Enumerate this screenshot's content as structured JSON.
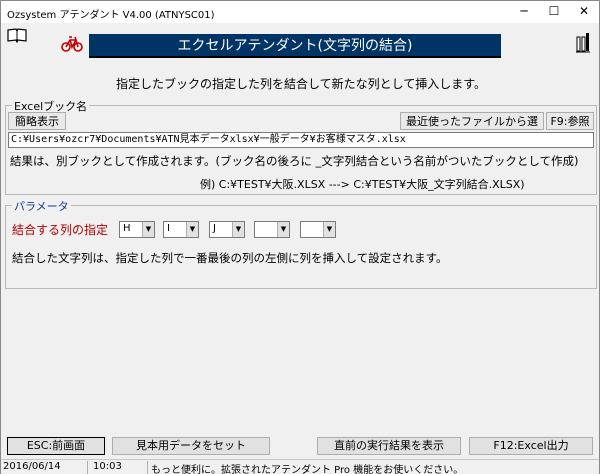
{
  "window": {
    "title": "Ozsystem アテンダント V4.00 (ATNYSC01)",
    "min_label": "─",
    "max_label": "☐",
    "close_label": "✕"
  },
  "header": {
    "banner": "エクセルアテンダント(文字列の結合)",
    "banner_color": "#003366"
  },
  "intro": "指定したブックの指定した列を結合して新たな列として挿入します。",
  "excel_group": {
    "label": "Excelブック名",
    "brief_button": "簡略表示",
    "recent_button": "最近使ったファイルから選択",
    "ref_button": "F9:参照",
    "file_path": "C:¥Users¥ozcr7¥Documents¥ATN見本データxlsx¥一般データ¥お客様マスタ.xlsx",
    "note": "結果は、別ブックとして作成されます。(ブック名の後ろに _文字列結合という名前がついたブックとして作成)",
    "example": "例) C:¥TEST¥大阪.XLSX ---> C:¥TEST¥大阪_文字列結合.XLSX)"
  },
  "param_group": {
    "label": "パラメータ",
    "columns_label": "結合する列の指定",
    "columns": [
      "H",
      "I",
      "J",
      "",
      ""
    ],
    "note": "結合した文字列は、指定した列で一番最後の列の左側に列を挿入して設定されます。"
  },
  "footer": {
    "esc_button": "ESC:前画面",
    "sample_button": "見本用データをセット",
    "prev_result_button": "直前の実行結果を表示",
    "f12_button": "F12:Excel出力"
  },
  "status": {
    "date": "2016/06/14",
    "time": "10:03",
    "message": "もっと便利に。拡張されたアテンダント Pro 機能をお使いください。"
  }
}
